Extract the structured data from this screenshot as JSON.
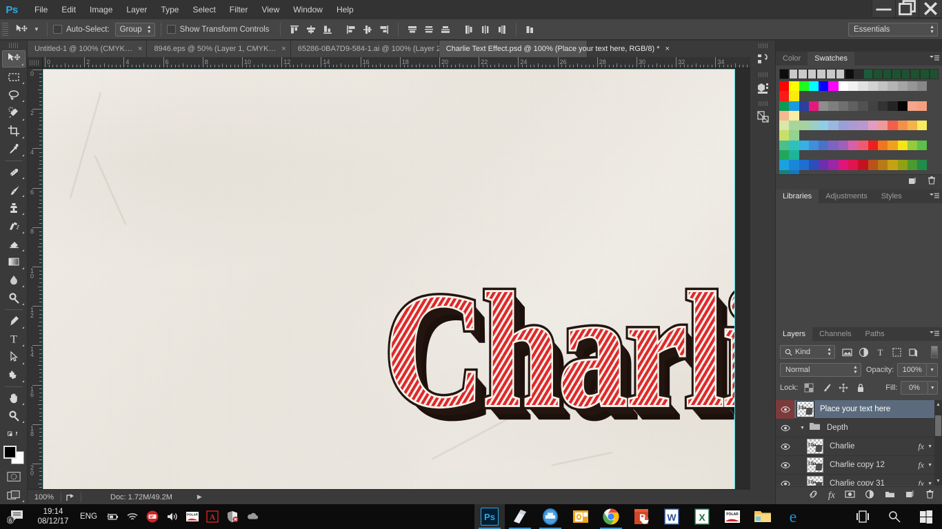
{
  "app": {
    "logo": "Ps",
    "menus": [
      "File",
      "Edit",
      "Image",
      "Layer",
      "Type",
      "Select",
      "Filter",
      "View",
      "Window",
      "Help"
    ],
    "window_buttons": {
      "minimize": "─",
      "restore": "❐",
      "close": "✕"
    }
  },
  "options_bar": {
    "tool_icon": "move-tool-icon",
    "auto_select_label": "Auto-Select:",
    "auto_select_value": "Group",
    "auto_select_checked": false,
    "show_transform_label": "Show Transform Controls",
    "show_transform_checked": false,
    "align_icons": [
      "align-top-edges-icon",
      "align-vertical-centers-icon",
      "align-bottom-edges-icon",
      "align-left-edges-icon",
      "align-horizontal-centers-icon",
      "align-right-edges-icon",
      "distribute-top-icon",
      "distribute-vertical-center-icon",
      "distribute-bottom-icon",
      "distribute-left-icon",
      "distribute-horizontal-center-icon",
      "distribute-right-icon",
      "auto-align-layers-icon"
    ],
    "workspace": "Essentials"
  },
  "tabs": [
    {
      "label": "Untitled-1 @ 100% (CMYK…",
      "active": false,
      "close": "×"
    },
    {
      "label": "8946.eps @ 50% (Layer 1, CMYK…",
      "active": false,
      "close": "×"
    },
    {
      "label": "65286-0BA7D9-584-1.ai @ 100% (Layer 2…",
      "active": false,
      "close": "×"
    },
    {
      "label": "Charlie Text Effect.psd @ 100%  (Place your text here, RGB/8) *",
      "active": true,
      "close": "×"
    }
  ],
  "toolbar": {
    "tools": [
      {
        "name": "move-tool",
        "active": true
      },
      {
        "name": "rectangular-marquee-tool",
        "active": false
      },
      {
        "name": "lasso-tool",
        "active": false
      },
      {
        "name": "quick-selection-tool",
        "active": false
      },
      {
        "name": "crop-tool",
        "active": false
      },
      {
        "name": "eyedropper-tool",
        "active": false
      },
      {
        "name": "spot-healing-brush-tool",
        "active": false
      },
      {
        "name": "brush-tool",
        "active": false
      },
      {
        "name": "clone-stamp-tool",
        "active": false
      },
      {
        "name": "history-brush-tool",
        "active": false
      },
      {
        "name": "eraser-tool",
        "active": false
      },
      {
        "name": "gradient-tool",
        "active": false
      },
      {
        "name": "blur-tool",
        "active": false
      },
      {
        "name": "dodge-tool",
        "active": false
      },
      {
        "name": "pen-tool",
        "active": false
      },
      {
        "name": "type-tool",
        "active": false
      },
      {
        "name": "path-selection-tool",
        "active": false
      },
      {
        "name": "custom-shape-tool",
        "active": false
      },
      {
        "name": "hand-tool",
        "active": false
      },
      {
        "name": "zoom-tool",
        "active": false
      }
    ],
    "foreground_color": "#000000",
    "background_color": "#ffffff"
  },
  "canvas": {
    "ruler_h_labels": [
      "0",
      "2",
      "4",
      "6",
      "8",
      "10",
      "12",
      "14",
      "16",
      "18",
      "20",
      "22",
      "24",
      "26",
      "28",
      "30",
      "32",
      "34"
    ],
    "ruler_v_labels": [
      "0",
      "2",
      "4",
      "6",
      "8",
      "10",
      "12",
      "14",
      "16",
      "18",
      "20"
    ],
    "artwork_text": "Charlie",
    "guide_color": "#4bd9e0",
    "paper_color": "#efece6",
    "stripe_red": "#e0282b",
    "stripe_cream": "#f5f2ea",
    "shadow_color": "#23150f"
  },
  "status_bar": {
    "zoom": "100%",
    "doc": "Doc: 1.72M/49.2M",
    "share_icon": "share-icon",
    "arrow": "▶"
  },
  "rail_icons": [
    "history-icon",
    "3d-icon",
    "properties-icon"
  ],
  "color_dock": {
    "tabs": [
      {
        "label": "Color",
        "active": false
      },
      {
        "label": "Swatches",
        "active": true
      }
    ],
    "menu_icon": "panel-menu-icon",
    "top_row": [
      "#0d0d0d",
      "#c9c9c9",
      "#c9c9c9",
      "#c9c9c9",
      "#c9c9c9",
      "#c9c9c9",
      "#c9c9c9",
      "#0d0d0d",
      "#2b2b2b",
      "#1a5c3a",
      "#1d5230",
      "#1d5230",
      "#1d5230",
      "#1d5230",
      "#1d5230",
      "#1d5230",
      "#1d5230"
    ],
    "grid": [
      [
        "#fb0404",
        "#fcfc04",
        "#1efc1e",
        "#04fcfc",
        "#0404fc",
        "#fc04fc",
        "#ffffff",
        "#f1f1f1",
        "#e1e1e1",
        "#d2d2d2",
        "#c3c3c3",
        "#b4b4b4",
        "#a5a5a5",
        "#969696",
        "#878787",
        "#fa1a1a",
        "#fbe90f"
      ],
      [
        "#0d9a55",
        "#1b9ae0",
        "#2b3f9e",
        "#e5197a",
        "#8d8d8d",
        "#7e7e7e",
        "#6f6f6f",
        "#606060",
        "#515151",
        "#424242",
        "#333333",
        "#242424",
        "#050505",
        "#f4a58a",
        "#f4a07e",
        "#f6b88e",
        "#f9eca4"
      ],
      [
        "#d9e8a8",
        "#a9d49a",
        "#a6d2a0",
        "#9ad0c1",
        "#8fcde6",
        "#9ab7e0",
        "#9c9ed8",
        "#ab9ad4",
        "#b997cf",
        "#e59ac0",
        "#ef9a9a",
        "#f2604a",
        "#f2914a",
        "#f5b24a",
        "#f9ec5a",
        "#c8e06a",
        "#95d18f"
      ],
      [
        "#4cbf8a",
        "#2fc0bd",
        "#36b0e6",
        "#3f8fdc",
        "#4b71c8",
        "#7f63c0",
        "#a05fb8",
        "#d85fa8",
        "#ef5a72",
        "#f01f1f",
        "#f0761f",
        "#f0a01f",
        "#f7e316",
        "#92cc3a",
        "#5cc04a",
        "#1fa85c",
        "#1fb39a"
      ],
      [
        "#1ca0e0",
        "#1a86d8",
        "#1e6fd0",
        "#2b4fb8",
        "#6c2fae",
        "#9a27a5",
        "#e0147a",
        "#e01450",
        "#c41221",
        "#b8541a",
        "#b87a16",
        "#c4a214",
        "#92a013",
        "#4b9a2f",
        "#1f8c4a",
        "#1a7f7a",
        "#1a74b8"
      ],
      [
        "#1a5f9e",
        "#241a7a",
        "#3b1a7a",
        "#5e1a74",
        "#8f1a5e",
        "#a0143f",
        "#8a1216",
        "#7a3a10",
        "#8a5e10",
        "#8a9a12",
        "#3f8a2a",
        "#1f7a2f",
        "#1f7a5a",
        "#1a6a72",
        "#1a5f9e",
        "#1a3c92",
        "#140f6e"
      ],
      [
        "#3b0f3b",
        "#5a0f3b",
        "#6e0f2f",
        "#8a0f24",
        "#dcc09a",
        "#b89a7a",
        "#9a8268",
        "#7a6a56",
        "#3b332b",
        "#d4a06a",
        "#c49058",
        "#b87f4a",
        "#a06a34",
        "#8a5a2a"
      ]
    ],
    "footer_icons": [
      "new-swatch-icon",
      "delete-swatch-icon"
    ]
  },
  "libraries_dock": {
    "tabs": [
      {
        "label": "Libraries",
        "active": true
      },
      {
        "label": "Adjustments",
        "active": false
      },
      {
        "label": "Styles",
        "active": false
      }
    ],
    "menu_icon": "panel-menu-icon"
  },
  "layers_dock": {
    "tabs": [
      {
        "label": "Layers",
        "active": true
      },
      {
        "label": "Channels",
        "active": false
      },
      {
        "label": "Paths",
        "active": false
      }
    ],
    "menu_icon": "panel-menu-icon",
    "filter_label": "Kind",
    "filter_icons": [
      "pixel-layer-filter-icon",
      "adjustment-layer-filter-icon",
      "type-layer-filter-icon",
      "shape-layer-filter-icon",
      "smart-object-filter-icon"
    ],
    "blend_mode": "Normal",
    "opacity_label": "Opacity:",
    "opacity_value": "100%",
    "lock_label": "Lock:",
    "lock_icons": [
      "lock-transparent-pixels-icon",
      "lock-image-pixels-icon",
      "lock-position-icon",
      "lock-all-icon"
    ],
    "fill_label": "Fill:",
    "fill_value": "0%",
    "layers": [
      {
        "name": "Place your text here",
        "selected": true,
        "visible": true,
        "type": "layer",
        "fx": false,
        "indent": 0
      },
      {
        "name": "Depth",
        "selected": false,
        "visible": true,
        "type": "group",
        "fx": false,
        "indent": 0,
        "expanded": true
      },
      {
        "name": "Charlie",
        "selected": false,
        "visible": true,
        "type": "layer",
        "fx": true,
        "indent": 1
      },
      {
        "name": "Charlie copy 12",
        "selected": false,
        "visible": true,
        "type": "layer",
        "fx": true,
        "indent": 1
      },
      {
        "name": "Charlie copy 31",
        "selected": false,
        "visible": true,
        "type": "layer",
        "fx": true,
        "indent": 1
      }
    ],
    "fx_label": "fx",
    "footer_icons": [
      "link-layers-icon",
      "add-layer-style-icon",
      "add-layer-mask-icon",
      "new-adjustment-layer-icon",
      "new-group-icon",
      "new-layer-icon",
      "delete-layer-icon"
    ],
    "selected_row_color": "#5b6b7d",
    "eye_selected_color": "#7d3a3a"
  },
  "taskbar": {
    "chat_badge": "6",
    "time": "19:14",
    "date": "08/12/17",
    "language": "ENG",
    "tray_icons": [
      "battery-icon",
      "wifi-icon",
      "antivirus-icon",
      "volume-icon",
      "polar-icon",
      "adobe-reader-icon",
      "security-shield-icon",
      "onedrive-icon"
    ],
    "apps": [
      {
        "name": "photoshop",
        "label": "Ps",
        "running": true
      },
      {
        "name": "notepad",
        "label": "",
        "running": true
      },
      {
        "name": "printer",
        "label": "",
        "running": true
      },
      {
        "name": "outlook",
        "label": "",
        "running": false
      },
      {
        "name": "chrome",
        "label": "",
        "running": true
      },
      {
        "name": "powerpoint",
        "label": "P",
        "running": false
      },
      {
        "name": "word",
        "label": "W",
        "running": false
      },
      {
        "name": "excel",
        "label": "X",
        "running": false
      },
      {
        "name": "polar",
        "label": "",
        "running": false
      },
      {
        "name": "file-explorer",
        "label": "",
        "running": false
      },
      {
        "name": "edge",
        "label": "e",
        "running": false
      }
    ],
    "right_icons": [
      "task-view-icon",
      "search-icon",
      "start-icon"
    ]
  }
}
